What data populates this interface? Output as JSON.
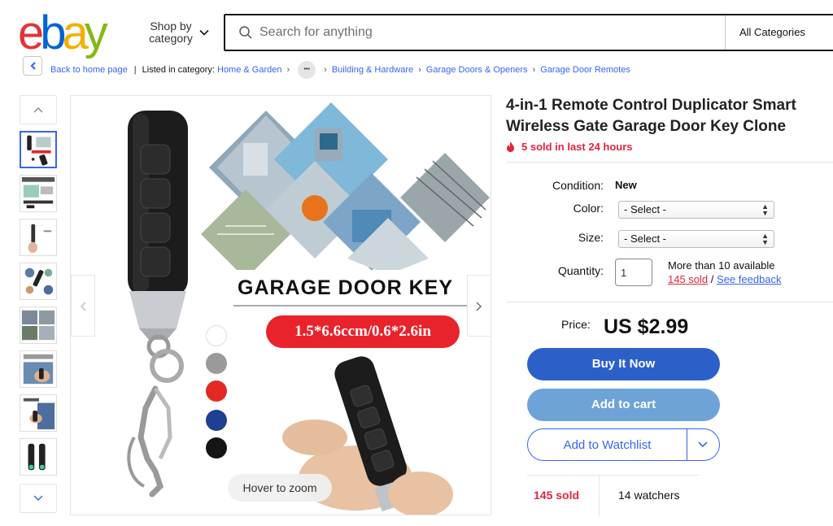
{
  "header": {
    "logo_letters": [
      "e",
      "b",
      "a",
      "y"
    ],
    "logo_colors": [
      "#e53238",
      "#0064d2",
      "#f5af02",
      "#86b817"
    ],
    "shop_by_label": "Shop by category",
    "search_placeholder": "Search for anything",
    "category_select": "All Categories"
  },
  "breadcrumb": {
    "back_label": "Back to home page",
    "listed_in": "Listed in category:",
    "items": [
      "Home & Garden",
      "Building & Hardware",
      "Garage Doors & Openers",
      "Garage Door Remotes"
    ],
    "ellipsis": "•••"
  },
  "gallery": {
    "thumb_count": 8,
    "active_thumb": 1,
    "banner_text": "GARAGE DOOR KEY",
    "size_text": "1.5*6.6ccm/0.6*2.6in",
    "swatch_colors": [
      "#ffffff",
      "#9a9a9a",
      "#e32826",
      "#1f3f93",
      "#151515"
    ],
    "zoom_hint": "Hover to zoom"
  },
  "listing": {
    "title": "4-in-1 Remote Control Duplicator Smart Wireless Gate Garage Door Key Clone",
    "sold_recent": "5 sold in last 24 hours",
    "condition_label": "Condition:",
    "condition_value": "New",
    "color_label": "Color:",
    "color_value": "- Select -",
    "size_label": "Size:",
    "size_value": "- Select -",
    "quantity_label": "Quantity:",
    "quantity_value": "1",
    "availability": "More than 10 available",
    "sold_link": "145 sold",
    "slash": "/",
    "feedback_link": "See feedback",
    "price_label": "Price:",
    "price_value": "US $2.99",
    "buy_now": "Buy It Now",
    "add_to_cart": "Add to cart",
    "add_to_watchlist": "Add to Watchlist",
    "stats_sold": "145 sold",
    "stats_watchers": "14 watchers"
  }
}
